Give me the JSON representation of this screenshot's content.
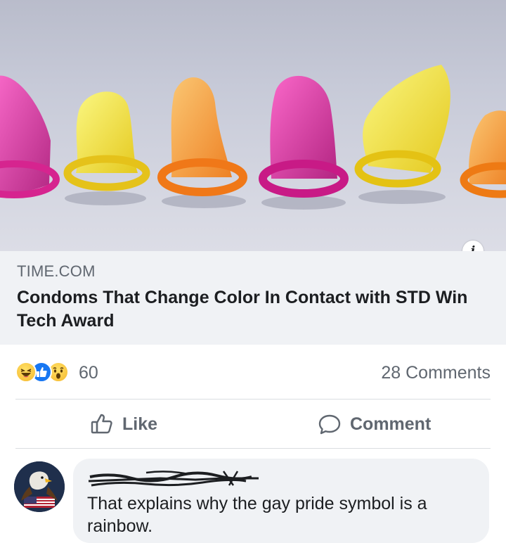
{
  "link_preview": {
    "domain": "TIME.COM",
    "headline": "Condoms That Change Color In Contact with STD Win Tech Award",
    "info_icon": "i"
  },
  "reactions": {
    "icons": [
      "haha-icon",
      "like-icon",
      "wow-icon"
    ],
    "count": "60",
    "comments_label": "28 Comments"
  },
  "actions": {
    "like_label": "Like",
    "comment_label": "Comment"
  },
  "comment": {
    "text": "That explains why the gay pride symbol is a rainbow."
  },
  "colors": {
    "caption_background": "#f0f2f5",
    "muted_text": "#606770",
    "primary_text": "#1c1e21",
    "like_blue": "#1877f2"
  }
}
